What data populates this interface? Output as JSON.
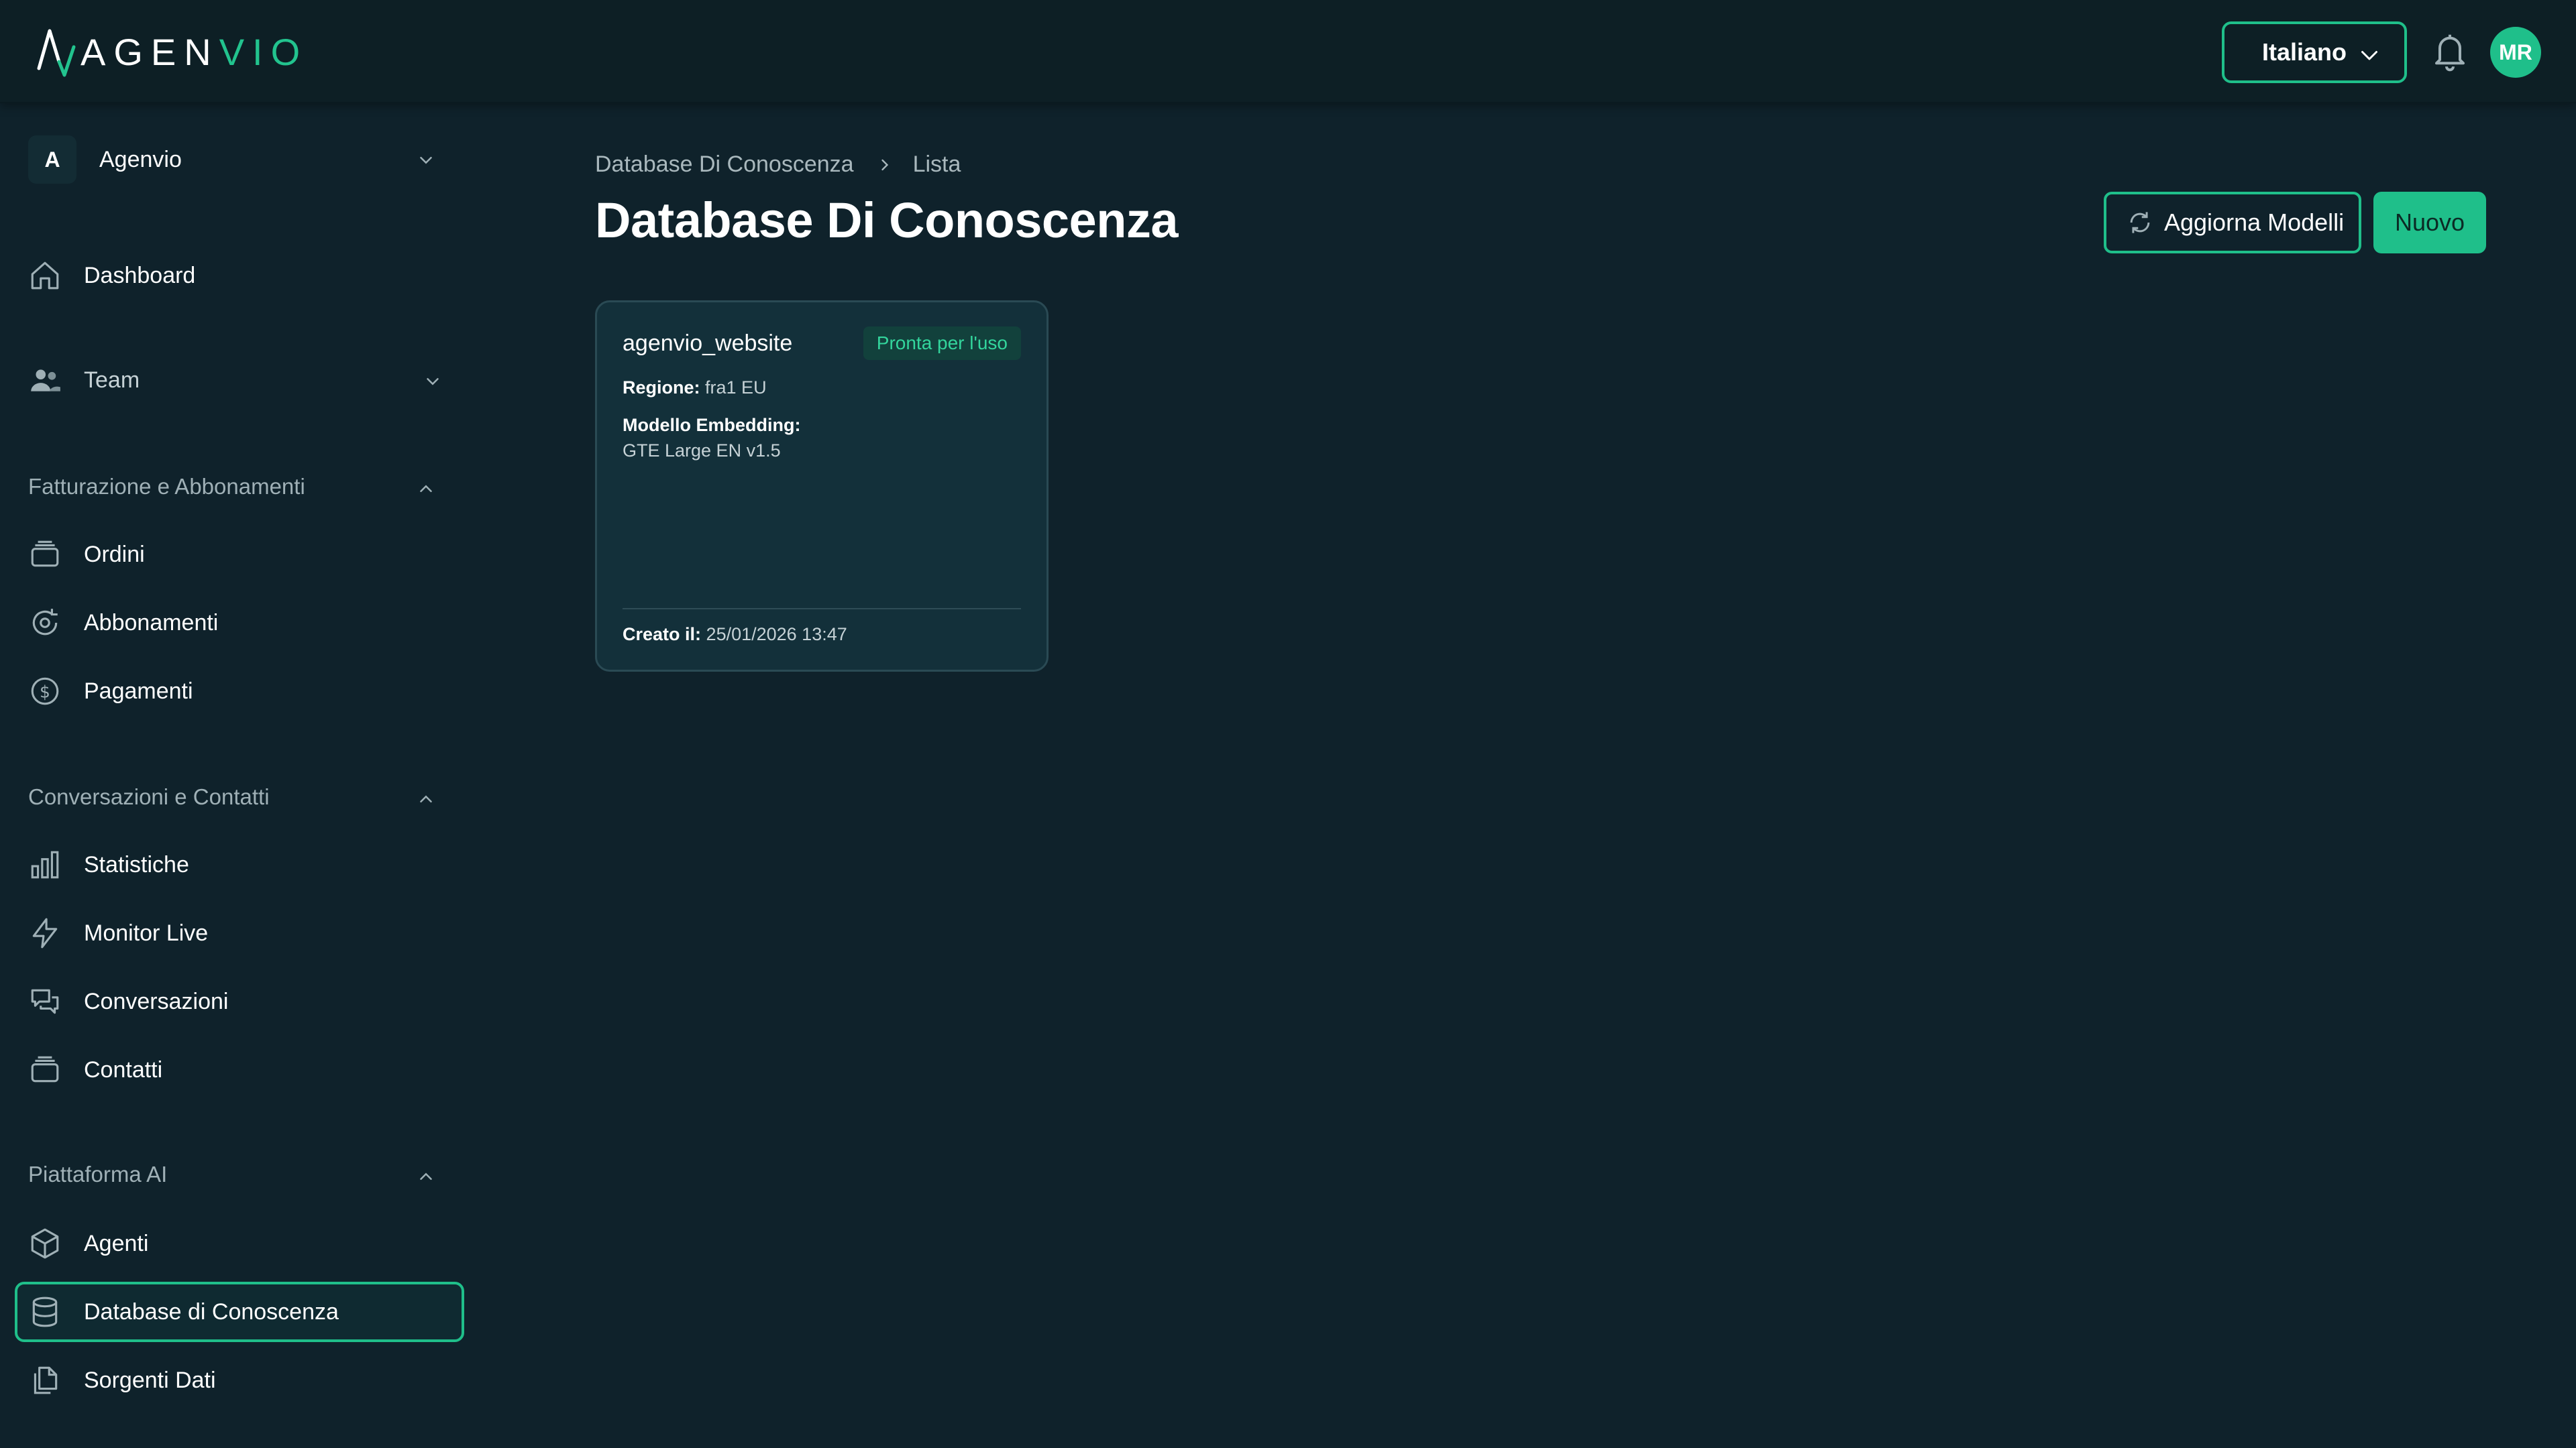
{
  "brand": {
    "logo_part1": "AGEN",
    "logo_part2": "VIO",
    "accent": "#1fbf8a"
  },
  "header": {
    "language": "Italiano",
    "avatar_initials": "MR"
  },
  "sidebar": {
    "org_initial": "A",
    "org_name": "Agenvio",
    "dashboard": "Dashboard",
    "team": "Team",
    "sections": {
      "billing": "Fatturazione e Abbonamenti",
      "conversations": "Conversazioni e Contatti",
      "ai": "Piattaforma AI"
    },
    "items": {
      "orders": "Ordini",
      "subscriptions": "Abbonamenti",
      "payments": "Pagamenti",
      "stats": "Statistiche",
      "monitor": "Monitor Live",
      "conversations": "Conversazioni",
      "contacts": "Contatti",
      "agents": "Agenti",
      "knowledge": "Database di Conoscenza",
      "sources": "Sorgenti Dati"
    }
  },
  "main": {
    "breadcrumb": [
      "Database Di Conoscenza",
      "Lista"
    ],
    "title": "Database Di Conoscenza",
    "refresh_button": "Aggiorna Modelli",
    "new_button": "Nuovo",
    "card": {
      "name": "agenvio_website",
      "status": "Pronta per l'uso",
      "region_label": "Regione:",
      "region_value": "fra1 EU",
      "model_label": "Modello Embedding:",
      "model_value": "GTE Large EN v1.5",
      "created_label": "Creato il:",
      "created_value": "25/01/2026 13:47"
    }
  }
}
